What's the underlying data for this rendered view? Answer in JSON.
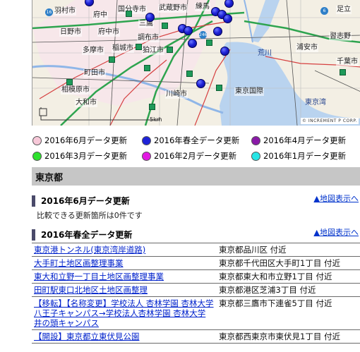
{
  "map": {
    "labels": {
      "hamura": "羽村市",
      "fuchu": "府中",
      "kokubunji": "国分寺市",
      "musashino": "武蔵野市",
      "nerima": "練馬",
      "adachi": "足立",
      "hino": "日野市",
      "fuchu_city": "府中市",
      "mitaka": "三鷹",
      "chofu": "調布市",
      "tama": "多摩市",
      "inagi": "稲城市",
      "komae": "狛江市",
      "machida": "町田市",
      "sagamihara": "相模原市",
      "yamato": "大和市",
      "kawasaki": "川崎市",
      "urayasu": "浦安市",
      "chiba": "千葉市",
      "arakawa": "荒川",
      "haneda": "東京国際",
      "narashino": "習志野",
      "tokyo_bay": "東京湾"
    },
    "scale": "5km",
    "copyright": "© INCREMENT P CORP."
  },
  "legend": [
    [
      {
        "label": "2016年6月データ更新",
        "color": "#f7c8d8"
      },
      {
        "label": "2016年春全データ更新",
        "color": "#1e22d8"
      },
      {
        "label": "2016年4月データ更新",
        "color": "#8a1aa8"
      }
    ],
    [
      {
        "label": "2016年3月データ更新",
        "color": "#2ee12e"
      },
      {
        "label": "2016年2月データ更新",
        "color": "#e21ae2"
      },
      {
        "label": "2016年1月データ更新",
        "color": "#28e6e6"
      }
    ]
  ],
  "section": {
    "title": "東京都"
  },
  "subsections": [
    {
      "title": "2016年6月データ更新",
      "link": "▲地図表示へ",
      "note": "比較できる更新箇所は0件です"
    },
    {
      "title": "2016年春全データ更新",
      "link": "▲地図表示へ"
    }
  ],
  "updates": [
    {
      "name": "東京港トンネル(東京湾岸道路)",
      "location": "東京都品川区 付近"
    },
    {
      "name": "大手町土地区画整理事業",
      "location": "東京都千代田区大手町1丁目 付近"
    },
    {
      "name": "東大和立野一丁目土地区画整理事業",
      "location": "東京都東大和市立野1丁目 付近"
    },
    {
      "name": "田町駅東口北地区土地区画整理",
      "location": "東京都港区芝浦3丁目 付近"
    },
    {
      "name": "【移転】【名称変更】学校法人 杏林学園 杏林大学 八王子キャンパス→学校法人杏林学園 杏林大学 井の頭キャンパス",
      "location": "東京都三鷹市下連雀5丁目 付近"
    },
    {
      "name": "【開設】東京都立東伏見公園",
      "location": "東京都西東京市東伏見1丁目 付近"
    }
  ]
}
